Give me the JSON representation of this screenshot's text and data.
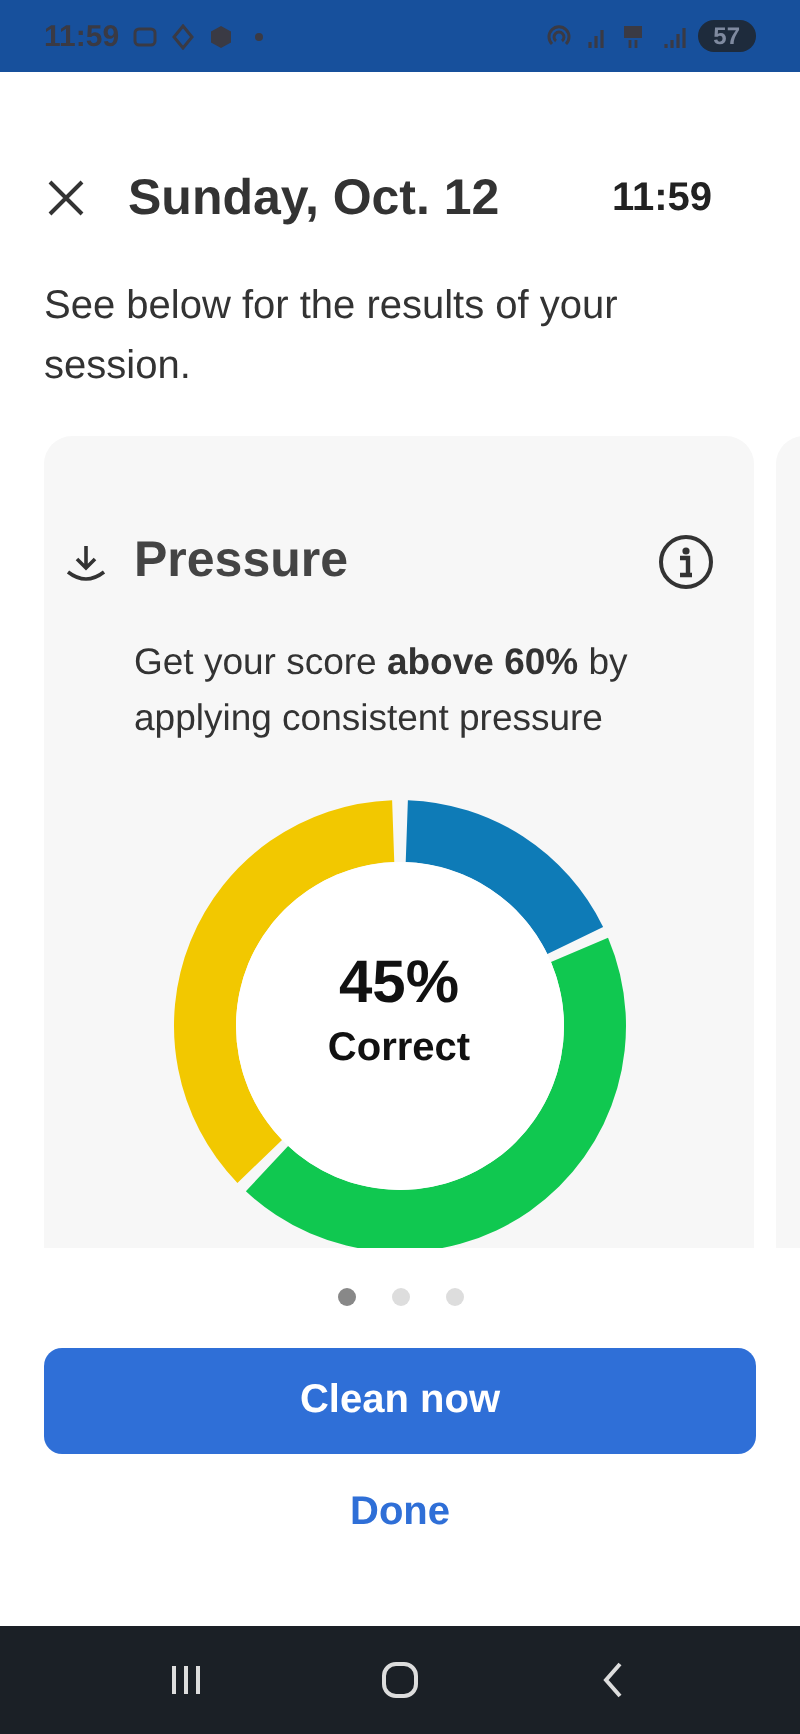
{
  "status_bar": {
    "time": "11:59",
    "battery": "57"
  },
  "header": {
    "title": "Sunday, Oct. 12",
    "time": "11:59"
  },
  "subtitle": "See below for the results of your session.",
  "card": {
    "title": "Pressure",
    "description": "Get your score **above 60%** by applying consistent pressure",
    "score": "45%",
    "score_label": "Correct"
  },
  "pager": [
    {
      "selected": true
    },
    {
      "selected": false
    },
    {
      "selected": false
    }
  ],
  "buttons": {
    "primary": "Clean now",
    "secondary": "Done"
  }
}
